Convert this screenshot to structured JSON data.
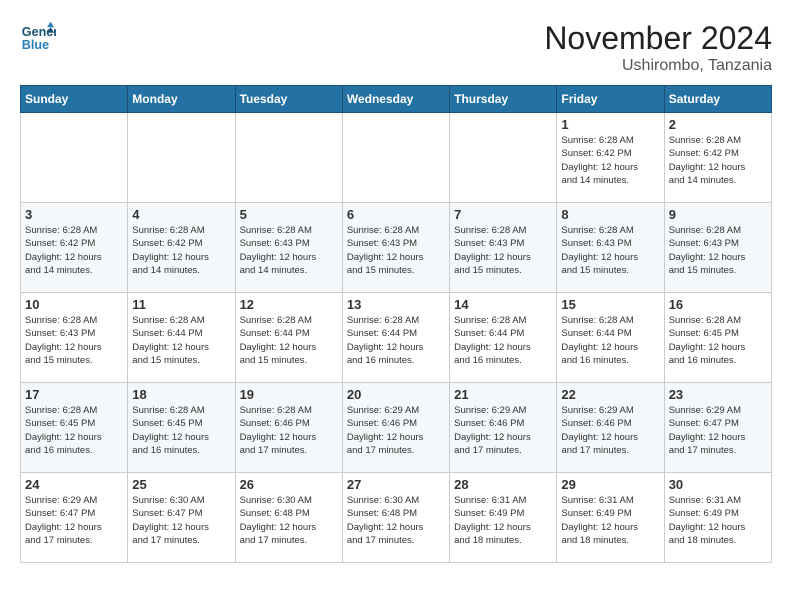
{
  "header": {
    "logo_line1": "General",
    "logo_line2": "Blue",
    "month": "November 2024",
    "location": "Ushirombo, Tanzania"
  },
  "days_of_week": [
    "Sunday",
    "Monday",
    "Tuesday",
    "Wednesday",
    "Thursday",
    "Friday",
    "Saturday"
  ],
  "weeks": [
    [
      {
        "day": "",
        "info": ""
      },
      {
        "day": "",
        "info": ""
      },
      {
        "day": "",
        "info": ""
      },
      {
        "day": "",
        "info": ""
      },
      {
        "day": "",
        "info": ""
      },
      {
        "day": "1",
        "info": "Sunrise: 6:28 AM\nSunset: 6:42 PM\nDaylight: 12 hours\nand 14 minutes."
      },
      {
        "day": "2",
        "info": "Sunrise: 6:28 AM\nSunset: 6:42 PM\nDaylight: 12 hours\nand 14 minutes."
      }
    ],
    [
      {
        "day": "3",
        "info": "Sunrise: 6:28 AM\nSunset: 6:42 PM\nDaylight: 12 hours\nand 14 minutes."
      },
      {
        "day": "4",
        "info": "Sunrise: 6:28 AM\nSunset: 6:42 PM\nDaylight: 12 hours\nand 14 minutes."
      },
      {
        "day": "5",
        "info": "Sunrise: 6:28 AM\nSunset: 6:43 PM\nDaylight: 12 hours\nand 14 minutes."
      },
      {
        "day": "6",
        "info": "Sunrise: 6:28 AM\nSunset: 6:43 PM\nDaylight: 12 hours\nand 15 minutes."
      },
      {
        "day": "7",
        "info": "Sunrise: 6:28 AM\nSunset: 6:43 PM\nDaylight: 12 hours\nand 15 minutes."
      },
      {
        "day": "8",
        "info": "Sunrise: 6:28 AM\nSunset: 6:43 PM\nDaylight: 12 hours\nand 15 minutes."
      },
      {
        "day": "9",
        "info": "Sunrise: 6:28 AM\nSunset: 6:43 PM\nDaylight: 12 hours\nand 15 minutes."
      }
    ],
    [
      {
        "day": "10",
        "info": "Sunrise: 6:28 AM\nSunset: 6:43 PM\nDaylight: 12 hours\nand 15 minutes."
      },
      {
        "day": "11",
        "info": "Sunrise: 6:28 AM\nSunset: 6:44 PM\nDaylight: 12 hours\nand 15 minutes."
      },
      {
        "day": "12",
        "info": "Sunrise: 6:28 AM\nSunset: 6:44 PM\nDaylight: 12 hours\nand 15 minutes."
      },
      {
        "day": "13",
        "info": "Sunrise: 6:28 AM\nSunset: 6:44 PM\nDaylight: 12 hours\nand 16 minutes."
      },
      {
        "day": "14",
        "info": "Sunrise: 6:28 AM\nSunset: 6:44 PM\nDaylight: 12 hours\nand 16 minutes."
      },
      {
        "day": "15",
        "info": "Sunrise: 6:28 AM\nSunset: 6:44 PM\nDaylight: 12 hours\nand 16 minutes."
      },
      {
        "day": "16",
        "info": "Sunrise: 6:28 AM\nSunset: 6:45 PM\nDaylight: 12 hours\nand 16 minutes."
      }
    ],
    [
      {
        "day": "17",
        "info": "Sunrise: 6:28 AM\nSunset: 6:45 PM\nDaylight: 12 hours\nand 16 minutes."
      },
      {
        "day": "18",
        "info": "Sunrise: 6:28 AM\nSunset: 6:45 PM\nDaylight: 12 hours\nand 16 minutes."
      },
      {
        "day": "19",
        "info": "Sunrise: 6:28 AM\nSunset: 6:46 PM\nDaylight: 12 hours\nand 17 minutes."
      },
      {
        "day": "20",
        "info": "Sunrise: 6:29 AM\nSunset: 6:46 PM\nDaylight: 12 hours\nand 17 minutes."
      },
      {
        "day": "21",
        "info": "Sunrise: 6:29 AM\nSunset: 6:46 PM\nDaylight: 12 hours\nand 17 minutes."
      },
      {
        "day": "22",
        "info": "Sunrise: 6:29 AM\nSunset: 6:46 PM\nDaylight: 12 hours\nand 17 minutes."
      },
      {
        "day": "23",
        "info": "Sunrise: 6:29 AM\nSunset: 6:47 PM\nDaylight: 12 hours\nand 17 minutes."
      }
    ],
    [
      {
        "day": "24",
        "info": "Sunrise: 6:29 AM\nSunset: 6:47 PM\nDaylight: 12 hours\nand 17 minutes."
      },
      {
        "day": "25",
        "info": "Sunrise: 6:30 AM\nSunset: 6:47 PM\nDaylight: 12 hours\nand 17 minutes."
      },
      {
        "day": "26",
        "info": "Sunrise: 6:30 AM\nSunset: 6:48 PM\nDaylight: 12 hours\nand 17 minutes."
      },
      {
        "day": "27",
        "info": "Sunrise: 6:30 AM\nSunset: 6:48 PM\nDaylight: 12 hours\nand 17 minutes."
      },
      {
        "day": "28",
        "info": "Sunrise: 6:31 AM\nSunset: 6:49 PM\nDaylight: 12 hours\nand 18 minutes."
      },
      {
        "day": "29",
        "info": "Sunrise: 6:31 AM\nSunset: 6:49 PM\nDaylight: 12 hours\nand 18 minutes."
      },
      {
        "day": "30",
        "info": "Sunrise: 6:31 AM\nSunset: 6:49 PM\nDaylight: 12 hours\nand 18 minutes."
      }
    ]
  ]
}
